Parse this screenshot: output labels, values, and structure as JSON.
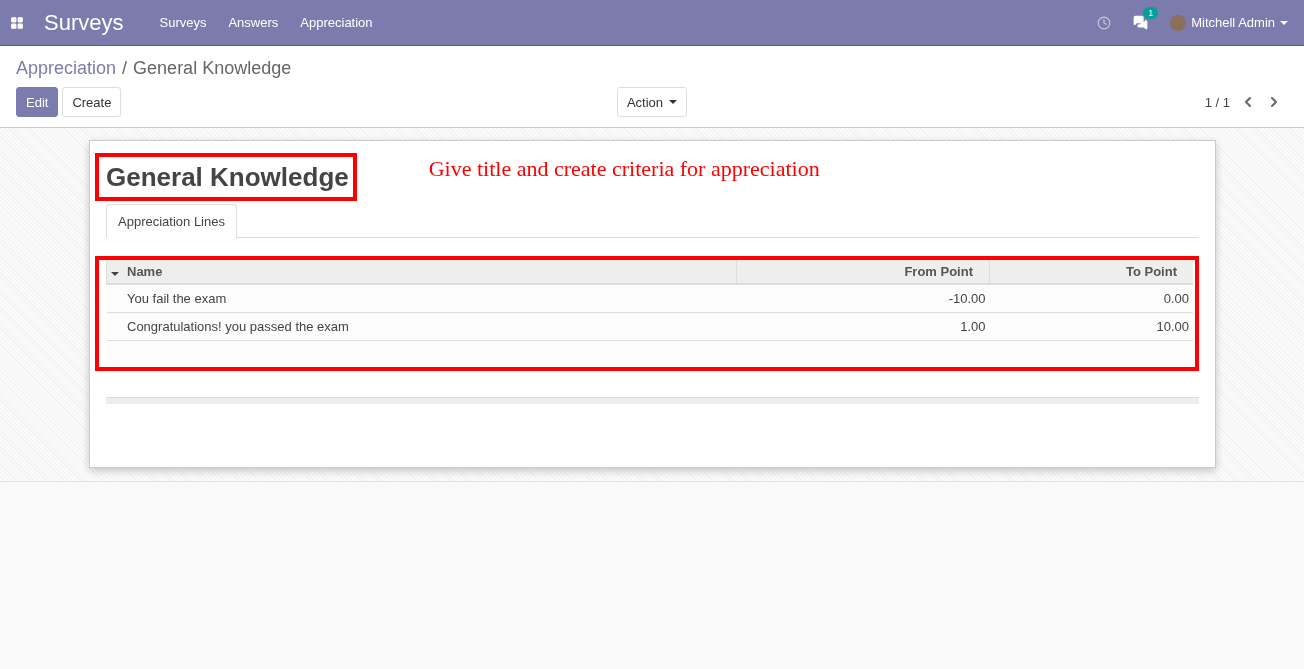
{
  "navbar": {
    "app_title": "Surveys",
    "menu": [
      "Surveys",
      "Answers",
      "Appreciation"
    ],
    "messages_badge": "1",
    "user": "Mitchell Admin"
  },
  "breadcrumb": {
    "parent": "Appreciation",
    "separator": "/",
    "current": "General Knowledge"
  },
  "buttons": [
    {
      "label": "Edit",
      "kind": "primary"
    },
    {
      "label": "Create",
      "kind": "secondary"
    }
  ],
  "action_menu": "Action",
  "pager": "1 / 1",
  "record": {
    "title": "General Knowledge",
    "annotation": "Give title and create criteria for appreciation",
    "tabs": [
      {
        "label": "Appreciation Lines",
        "selected": true
      }
    ],
    "table": {
      "columns": [
        "Name",
        "From Point",
        "To Point"
      ],
      "rows": [
        [
          "You fail the exam",
          "-10.00",
          "0.00"
        ],
        [
          "Congratulations! you passed the exam",
          "1.00",
          "10.00"
        ]
      ]
    }
  }
}
